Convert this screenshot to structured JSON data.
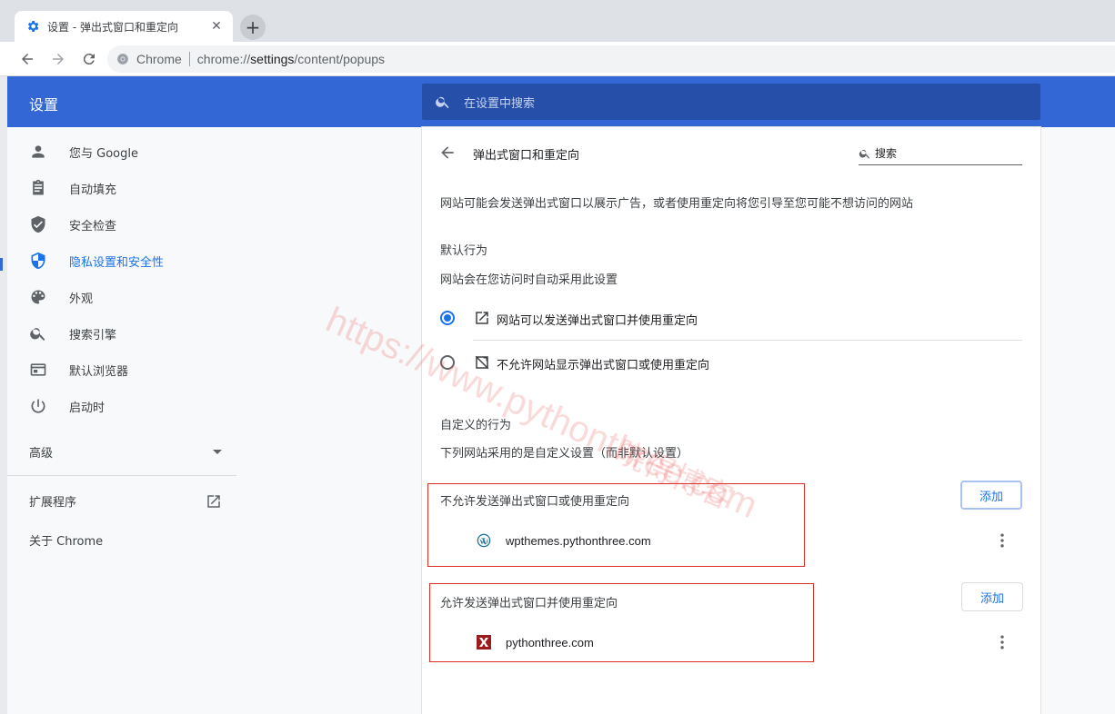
{
  "tab": {
    "title": "设置 - 弹出式窗口和重定向",
    "close": "✕",
    "new_tab": "+"
  },
  "omnibox": {
    "label": "Chrome",
    "url_prefix": "chrome://",
    "url_path": "settings",
    "url_rest": "/content/popups"
  },
  "header": {
    "title": "设置",
    "search_placeholder": "在设置中搜索"
  },
  "sidebar": {
    "items": [
      {
        "label": "您与 Google",
        "icon": "person-icon"
      },
      {
        "label": "自动填充",
        "icon": "clipboard-icon"
      },
      {
        "label": "安全检查",
        "icon": "shield-check-icon"
      },
      {
        "label": "隐私设置和安全性",
        "icon": "shield-icon",
        "active": true
      },
      {
        "label": "外观",
        "icon": "palette-icon"
      },
      {
        "label": "搜索引擎",
        "icon": "search-icon"
      },
      {
        "label": "默认浏览器",
        "icon": "browser-icon"
      },
      {
        "label": "启动时",
        "icon": "power-icon"
      }
    ],
    "advanced": "高级",
    "extensions": "扩展程序",
    "about": "关于 Chrome"
  },
  "main": {
    "title": "弹出式窗口和重定向",
    "search_value": "搜索",
    "description": "网站可能会发送弹出式窗口以展示广告，或者使用重定向将您引导至您可能不想访问的网站",
    "default_heading": "默认行为",
    "default_sub": "网站会在您访问时自动采用此设置",
    "option_allow": "网站可以发送弹出式窗口并使用重定向",
    "option_block": "不允许网站显示弹出式窗口或使用重定向",
    "custom_heading": "自定义的行为",
    "custom_sub": "下列网站采用的是自定义设置（而非默认设置）",
    "block_section": {
      "title": "不允许发送弹出式窗口或使用重定向",
      "add": "添加",
      "site": "wpthemes.pythonthree.com"
    },
    "allow_section": {
      "title": "允许发送弹出式窗口并使用重定向",
      "add": "添加",
      "site": "pythonthree.com"
    }
  },
  "watermark": {
    "url": "https://www.pythonthree.com",
    "name": "晓得博客"
  },
  "colors": {
    "accent": "#1a73e8",
    "header": "#3367d6",
    "highlight": "#d93025"
  }
}
